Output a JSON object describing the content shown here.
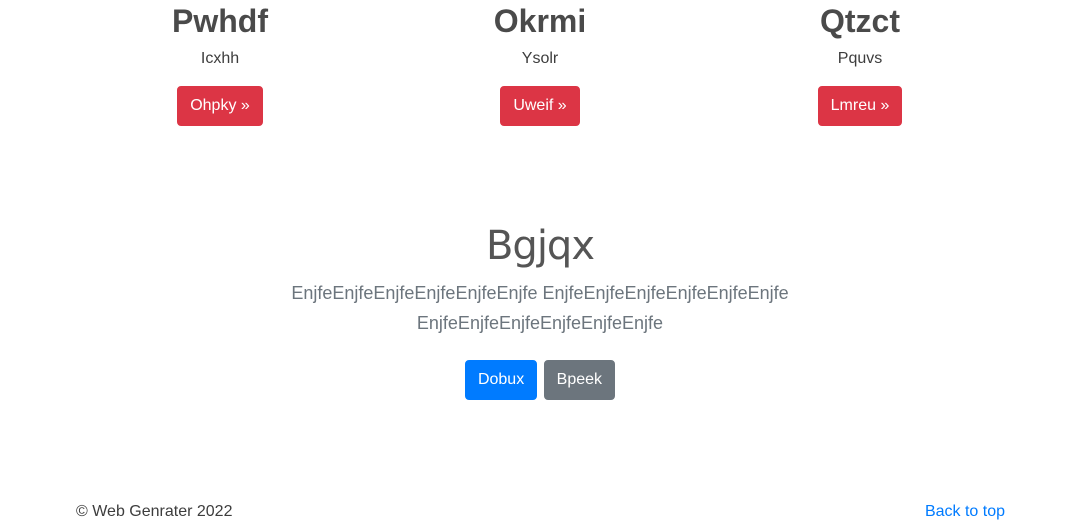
{
  "features": [
    {
      "title": "Pwhdf",
      "text": "Icxhh",
      "button": "Ohpky »"
    },
    {
      "title": "Okrmi",
      "text": "Ysolr",
      "button": "Uweif »"
    },
    {
      "title": "Qtzct",
      "text": "Pquvs",
      "button": "Lmreu »"
    }
  ],
  "jumbotron": {
    "heading": "Bgjqx",
    "lead": "EnjfeEnjfeEnjfeEnjfeEnjfeEnjfe EnjfeEnjfeEnjfeEnjfeEnjfeEnjfe EnjfeEnjfeEnjfeEnjfeEnjfeEnjfe",
    "primary_button": "Dobux",
    "secondary_button": "Bpeek"
  },
  "footer": {
    "copyright": "© Web Genrater 2022",
    "back_to_top": "Back to top"
  },
  "colors": {
    "danger": "#dc3545",
    "primary": "#007bff",
    "secondary": "#6c757d",
    "link": "#007bff"
  }
}
